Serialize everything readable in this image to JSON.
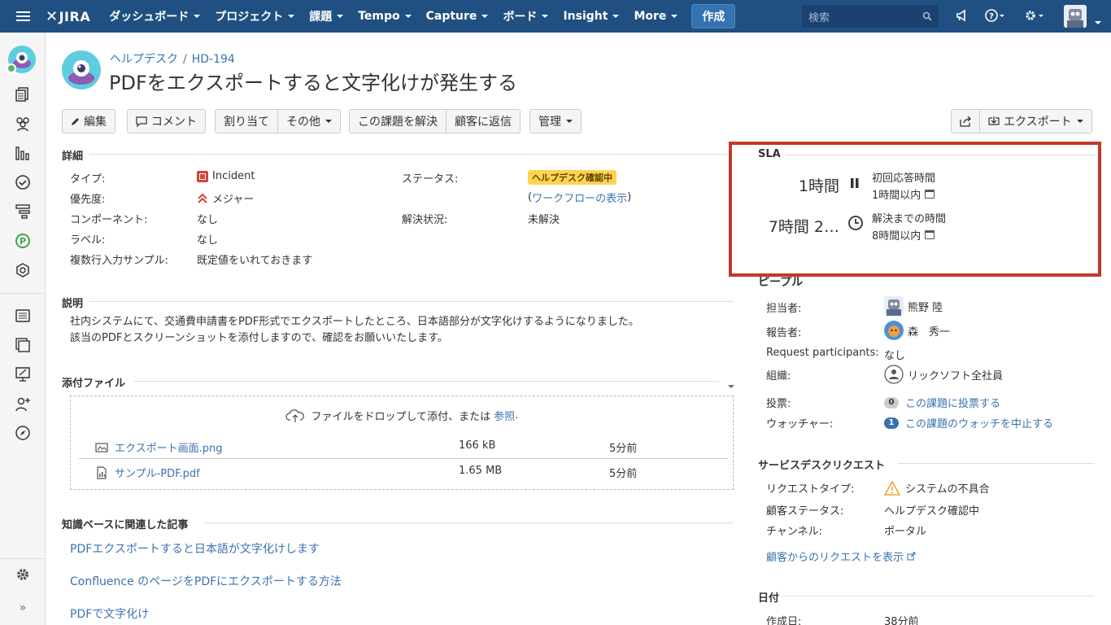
{
  "nav": {
    "logo": "JIRA",
    "items": [
      "ダッシュボード",
      "プロジェクト",
      "課題",
      "Tempo",
      "Capture",
      "ボード",
      "Insight",
      "More"
    ],
    "create": "作成",
    "search_placeholder": "検索"
  },
  "breadcrumb": {
    "project": "ヘルプデスク",
    "separator": "/",
    "key": "HD-194"
  },
  "title": "PDFをエクスポートすると文字化けが発生する",
  "toolbar": {
    "edit": "編集",
    "comment": "コメント",
    "assign": "割り当て",
    "more": "その他",
    "resolve": "この課題を解決",
    "reply": "顧客に返信",
    "admin": "管理",
    "export": "エクスポート"
  },
  "details": {
    "heading": "詳細",
    "type_label": "タイプ:",
    "type_value": "Incident",
    "priority_label": "優先度:",
    "priority_value": "メジャー",
    "component_label": "コンポーネント:",
    "component_value": "なし",
    "labels_label": "ラベル:",
    "labels_value": "なし",
    "multiline_label": "複数行入力サンプル:",
    "multiline_value": "既定値をいれておきます",
    "status_label": "ステータス:",
    "status_value": "ヘルプデスク確認中",
    "workflow_open": "(",
    "workflow_link": "ワークフローの表示",
    "workflow_close": ")",
    "resolution_label": "解決状況:",
    "resolution_value": "未解決"
  },
  "description": {
    "heading": "説明",
    "line1": "社内システムにて、交通費申請書をPDF形式でエクスポートしたところ、日本語部分が文字化けするようになりました。",
    "line2": "該当のPDFとスクリーンショットを添付しますので、確認をお願いいたします。"
  },
  "attachments": {
    "heading": "添付ファイル",
    "drop_text": "ファイルをドロップして添付、または",
    "browse": "参照",
    "browse_period": ".",
    "files": [
      {
        "name": "エクスポート画面.png",
        "size": "166 kB",
        "date": "5分前"
      },
      {
        "name": "サンプル-PDF.pdf",
        "size": "1.65 MB",
        "date": "5分前"
      }
    ]
  },
  "kb": {
    "heading": "知識ベースに関連した記事",
    "links": [
      "PDFエクスポートすると日本語が文字化けします",
      "Confluence のページをPDFにエクスポートする方法",
      "PDFで文字化け"
    ]
  },
  "sla": {
    "heading": "SLA",
    "items": [
      {
        "time": "1時間",
        "name": "初回応答時間",
        "goal": "1時間以内",
        "state": "paused"
      },
      {
        "time": "7時間 2…",
        "name": "解決までの時間",
        "goal": "8時間以内",
        "state": "running"
      }
    ]
  },
  "people": {
    "heading": "ピープル",
    "assignee_label": "担当者:",
    "assignee": "熊野 陸",
    "reporter_label": "報告者:",
    "reporter": "森　秀一",
    "participants_label": "Request participants:",
    "participants": "なし",
    "org_label": "組織:",
    "org": "リックソフト全社員",
    "votes_label": "投票:",
    "votes_count": "0",
    "votes_link": "この課題に投票する",
    "watchers_label": "ウォッチャー:",
    "watchers_count": "1",
    "watchers_link": "この課題のウォッチを中止する"
  },
  "service_desk": {
    "heading": "サービスデスクリクエスト",
    "type_label": "リクエストタイプ:",
    "type": "システムの不具合",
    "status_label": "顧客ステータス:",
    "status": "ヘルプデスク確認中",
    "channel_label": "チャンネル:",
    "channel": "ポータル",
    "view_link": "顧客からのリクエストを表示"
  },
  "dates": {
    "heading": "日付",
    "created_label": "作成日:",
    "created": "38分前"
  },
  "colors": {
    "nav": "#205081",
    "link": "#3b73af",
    "highlight": "#c0392b",
    "lozenge": "#ffd351"
  }
}
